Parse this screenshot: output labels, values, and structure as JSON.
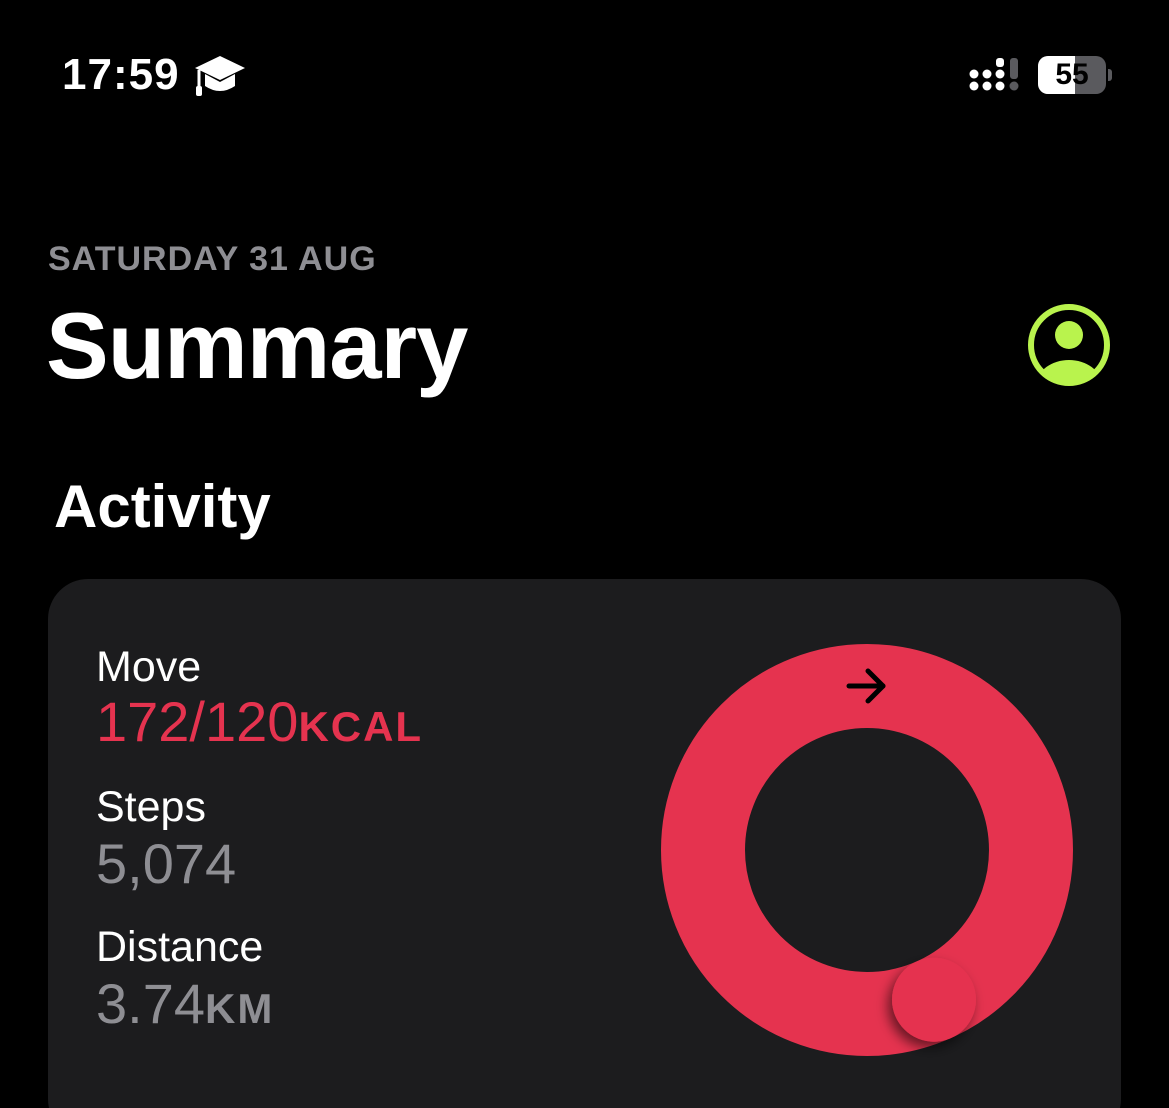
{
  "status_bar": {
    "time": "17:59",
    "battery_level": "55",
    "battery_fraction": 0.55
  },
  "icons": {
    "focus": "graduation-cap-icon",
    "signal": "signal-icon",
    "profile": "person-circle-icon",
    "ring_arrow": "arrow-right-icon"
  },
  "header": {
    "date": "SATURDAY 31 AUG",
    "title": "Summary"
  },
  "section": {
    "title": "Activity"
  },
  "activity": {
    "move": {
      "label": "Move",
      "value": "172/120",
      "unit": "KCAL",
      "progress_fraction": 1.433
    },
    "steps": {
      "label": "Steps",
      "value": "5,074"
    },
    "distance": {
      "label": "Distance",
      "value": "3.74",
      "unit": "KM"
    }
  },
  "colors": {
    "background": "#000000",
    "card": "#1c1c1e",
    "move_ring": "#e5334f",
    "accent_profile": "#b9f34d",
    "secondary_text": "#8e8e93"
  }
}
